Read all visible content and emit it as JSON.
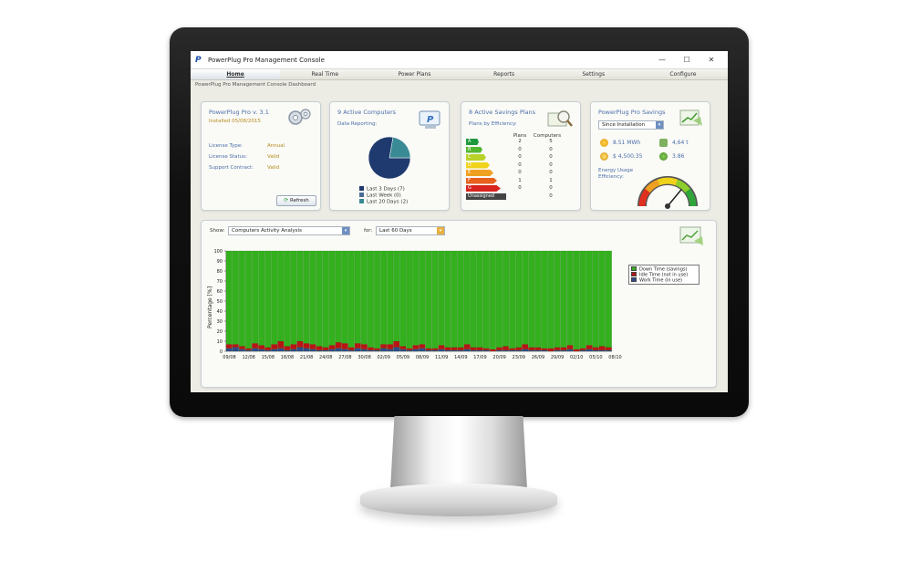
{
  "window": {
    "title": "PowerPlug Pro Management Console",
    "logo_letter": "P",
    "minimize": "—",
    "maximize": "☐",
    "close": "✕"
  },
  "nav": {
    "tabs": [
      {
        "label": "Home",
        "active": true
      },
      {
        "label": "Real Time"
      },
      {
        "label": "Power Plans"
      },
      {
        "label": "Reports"
      },
      {
        "label": "Settings"
      },
      {
        "label": "Configure"
      }
    ]
  },
  "breadcrumb": "PowerPlug Pro Management Console Dashboard",
  "license_panel": {
    "title": "PowerPlug Pro v. 3.1",
    "installed": "Installed 05/08/2015",
    "rows": [
      {
        "label": "License Type:",
        "value": "Annual"
      },
      {
        "label": "License Status:",
        "value": "Valid"
      },
      {
        "label": "Support Contract:",
        "value": "Valid"
      }
    ],
    "refresh_label": "Refresh"
  },
  "computers_panel": {
    "title": "9 Active Computers",
    "subtitle": "Data Reporting:",
    "legend": [
      {
        "label": "Last 3 Days (7)",
        "color": "#1f3a6e"
      },
      {
        "label": "Last Week (0)",
        "color": "#4a6b99"
      },
      {
        "label": "Last 20 Days (2)",
        "color": "#3a8a96"
      }
    ],
    "pie": [
      7,
      0,
      2
    ]
  },
  "plans_panel": {
    "title": "8 Active Savings Plans",
    "subtitle": "Plans by Efficiency:",
    "col_plans": "Plans",
    "col_computers": "Computers",
    "rows": [
      {
        "grade": "A",
        "plans": "2",
        "computers": "5",
        "color": "#1e9a3c"
      },
      {
        "grade": "B",
        "plans": "0",
        "computers": "0",
        "color": "#55b830"
      },
      {
        "grade": "C",
        "plans": "0",
        "computers": "0",
        "color": "#b8d228"
      },
      {
        "grade": "D",
        "plans": "0",
        "computers": "0",
        "color": "#f0d21a"
      },
      {
        "grade": "E",
        "plans": "0",
        "computers": "0",
        "color": "#f0a020"
      },
      {
        "grade": "F",
        "plans": "1",
        "computers": "1",
        "color": "#e6621e"
      },
      {
        "grade": "G",
        "plans": "0",
        "computers": "0",
        "color": "#d8241e"
      },
      {
        "grade": "Unassigned",
        "plans": "",
        "computers": "0",
        "color": "#444444"
      }
    ]
  },
  "savings_panel": {
    "title": "PowerPlug Pro Savings",
    "period": "Since Installation",
    "energy": "8.51 MWh",
    "co2": "4,64 t",
    "money": "$ 4,500.35",
    "trees": "3.86",
    "efficiency_label": "Energy Usage Efficiency:",
    "efficiency_level": 0.72
  },
  "chart_panel": {
    "show_label": "Show:",
    "show_value": "Computers Activity Analysis",
    "for_label": "for:",
    "for_value": "Last 60 Days"
  },
  "chart_data": {
    "type": "bar",
    "stacked": true,
    "ylabel": "Percentage [%]",
    "ylim": [
      0,
      100
    ],
    "yticks": [
      0,
      10,
      20,
      30,
      40,
      50,
      60,
      70,
      80,
      90,
      100
    ],
    "xtick_labels": [
      "09/08",
      "12/08",
      "15/08",
      "18/08",
      "21/08",
      "24/08",
      "27/08",
      "30/08",
      "02/09",
      "05/09",
      "08/09",
      "11/09",
      "14/09",
      "17/09",
      "20/09",
      "23/09",
      "26/09",
      "29/09",
      "02/10",
      "05/10",
      "08/10"
    ],
    "legend_placement": "top-right",
    "series": [
      {
        "name": "Down Time (savings)",
        "color": "#34b01e"
      },
      {
        "name": "Idle Time (not in use)",
        "color": "#b81414"
      },
      {
        "name": "Work Time (in use)",
        "color": "#2d4a8c"
      }
    ],
    "work_values": [
      3,
      4,
      2,
      1,
      3,
      2,
      1,
      2,
      3,
      1,
      2,
      4,
      3,
      2,
      1,
      1,
      2,
      3,
      2,
      1,
      3,
      2,
      1,
      1,
      3,
      2,
      4,
      2,
      1,
      2,
      3,
      1,
      1,
      2,
      1,
      1,
      1,
      2,
      1,
      1,
      1,
      0,
      1,
      1,
      1,
      1,
      2,
      1,
      1,
      1,
      0,
      1,
      1,
      2,
      0,
      1,
      2,
      1,
      1,
      1
    ],
    "idle_values": [
      4,
      3,
      3,
      2,
      5,
      4,
      3,
      5,
      7,
      4,
      5,
      6,
      5,
      5,
      4,
      3,
      4,
      6,
      6,
      3,
      5,
      5,
      3,
      2,
      4,
      5,
      6,
      3,
      2,
      4,
      4,
      2,
      2,
      4,
      3,
      3,
      3,
      5,
      3,
      3,
      2,
      2,
      3,
      4,
      2,
      3,
      5,
      3,
      3,
      2,
      3,
      3,
      3,
      4,
      2,
      2,
      4,
      3,
      4,
      3
    ]
  }
}
